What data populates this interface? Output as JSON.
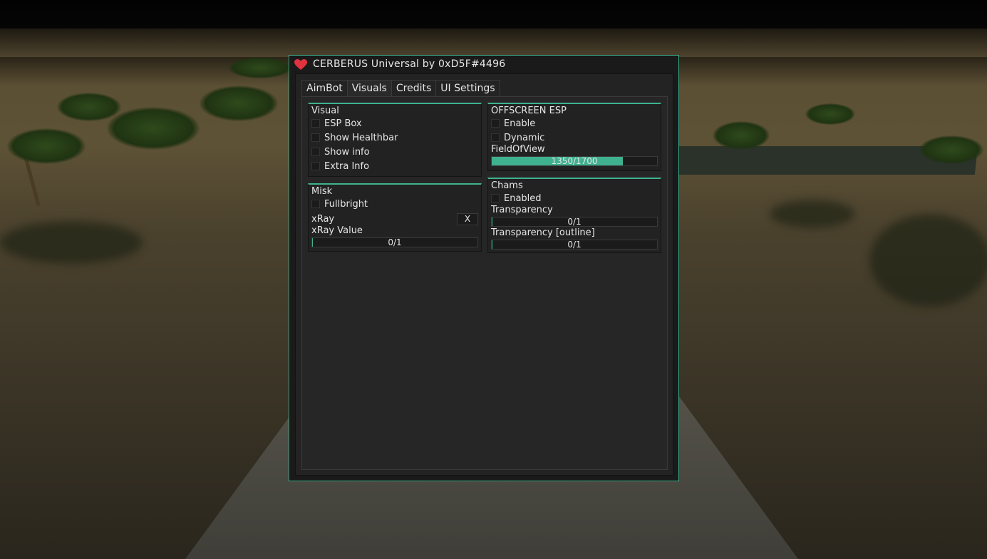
{
  "window": {
    "title": "CERBERUS Universal by 0xD5F#4496",
    "accent": "#3fb18f",
    "icon": "heart-icon",
    "icon_color": "#e0323f"
  },
  "tabs": [
    {
      "label": "AimBot",
      "active": false
    },
    {
      "label": "Visuals",
      "active": true
    },
    {
      "label": "Credits",
      "active": false
    },
    {
      "label": "UI Settings",
      "active": false
    }
  ],
  "visual": {
    "title": "Visual",
    "options": [
      "ESP Box",
      "Show Healthbar",
      "Show info",
      "Extra Info"
    ]
  },
  "misk": {
    "title": "Misk",
    "fullbright": "Fullbright",
    "xray_label": "xRay",
    "xray_key": "X",
    "xray_value_label": "xRay Value",
    "xray_value_text": "0/1",
    "xray_value_fraction": 0
  },
  "offscreen": {
    "title": "OFFSCREEN ESP",
    "enable": "Enable",
    "dynamic": "Dynamic",
    "fov_label": "FieldOfView",
    "fov_text": "1350/1700",
    "fov_fraction": 0.794
  },
  "chams": {
    "title": "Chams",
    "enabled": "Enabled",
    "transparency_label": "Transparency",
    "transparency_text": "0/1",
    "transparency_fraction": 0,
    "outline_label": "Transparency [outline]",
    "outline_text": "0/1",
    "outline_fraction": 0
  }
}
